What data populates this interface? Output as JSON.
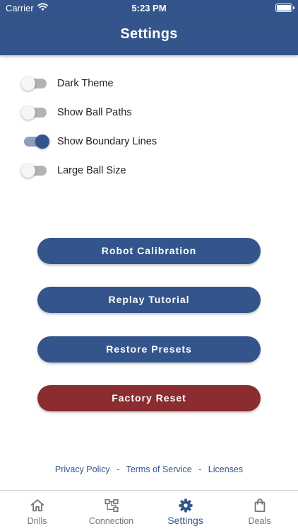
{
  "status_bar": {
    "carrier": "Carrier",
    "time": "5:23 PM"
  },
  "header": {
    "title": "Settings"
  },
  "toggles": [
    {
      "label": "Dark Theme",
      "on": false
    },
    {
      "label": "Show Ball Paths",
      "on": false
    },
    {
      "label": "Show Boundary Lines",
      "on": true
    },
    {
      "label": "Large Ball Size",
      "on": false
    }
  ],
  "actions": {
    "robot_calibration": "Robot Calibration",
    "replay_tutorial": "Replay Tutorial",
    "restore_presets": "Restore Presets",
    "factory_reset": "Factory Reset"
  },
  "footer": {
    "privacy_policy": "Privacy Policy",
    "terms_of_service": "Terms of Service",
    "licenses": "Licenses",
    "separator": "-"
  },
  "tab_bar": {
    "tabs": [
      {
        "label": "Drills",
        "icon": "home-icon",
        "active": false
      },
      {
        "label": "Connection",
        "icon": "connection-icon",
        "active": false
      },
      {
        "label": "Settings",
        "icon": "gear-icon",
        "active": true
      },
      {
        "label": "Deals",
        "icon": "shopping-bag-icon",
        "active": false
      }
    ]
  },
  "colors": {
    "primary": "#33558b",
    "danger": "#8a2c30",
    "toggle_off_track": "#b3b3b3",
    "toggle_on_track": "#8d9fbf"
  }
}
